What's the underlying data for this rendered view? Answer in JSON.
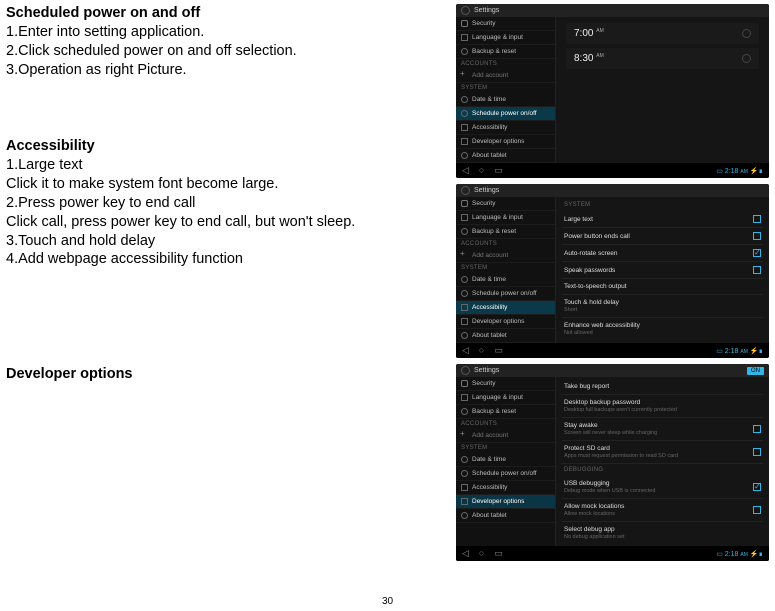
{
  "pageNumber": "30",
  "section1": {
    "title": "Scheduled power on and off",
    "steps": [
      "1.Enter into setting application.",
      "2.Click scheduled power on and off selection.",
      "3.Operation as right Picture."
    ]
  },
  "section2": {
    "title": "Accessibility",
    "lines": [
      "1.Large text",
      "Click it to make system font become large.",
      "2.Press power key to end call",
      "Click call, press power key to end call, but won't sleep.",
      "3.Touch and hold delay",
      "4.Add webpage accessibility function"
    ]
  },
  "section3": {
    "title": "Developer options"
  },
  "shotCommon": {
    "headerTitle": "Settings",
    "accounts": "ACCOUNTS",
    "system": "SYSTEM",
    "navSecurity": "Security",
    "navLang": "Language & input",
    "navBackup": "Backup & reset",
    "navAddAcct": "Add account",
    "navDate": "Date & time",
    "navSched": "Schedule power on/off",
    "navAccess": "Accessibility",
    "navDev": "Developer options",
    "navAbout": "About tablet",
    "clock": "2:18",
    "clockSuffix": "AM"
  },
  "shot1": {
    "time1": "7:00",
    "time1s": "AM",
    "time2": "8:30",
    "time2s": "AM"
  },
  "shot2": {
    "hdr": "SYSTEM",
    "r1": "Large text",
    "r2": "Power button ends call",
    "r3": "Auto-rotate screen",
    "r4": "Speak passwords",
    "r5": "Text-to-speech output",
    "r6": "Touch & hold delay",
    "r6s": "Short",
    "r7": "Enhance web accessibility",
    "r7s": "Not allowed"
  },
  "shot3": {
    "on": "ON",
    "r1": "Take bug report",
    "r2": "Desktop backup password",
    "r2s": "Desktop full backups aren't currently protected",
    "r3": "Stay awake",
    "r3s": "Screen will never sleep while charging",
    "r4": "Protect SD card",
    "r4s": "Apps must request permission to read SD card",
    "hdr": "DEBUGGING",
    "r5": "USB debugging",
    "r5s": "Debug mode when USB is connected",
    "r6": "Allow mock locations",
    "r6s": "Allow mock locations",
    "r7": "Select debug app",
    "r7s": "No debug application set"
  }
}
